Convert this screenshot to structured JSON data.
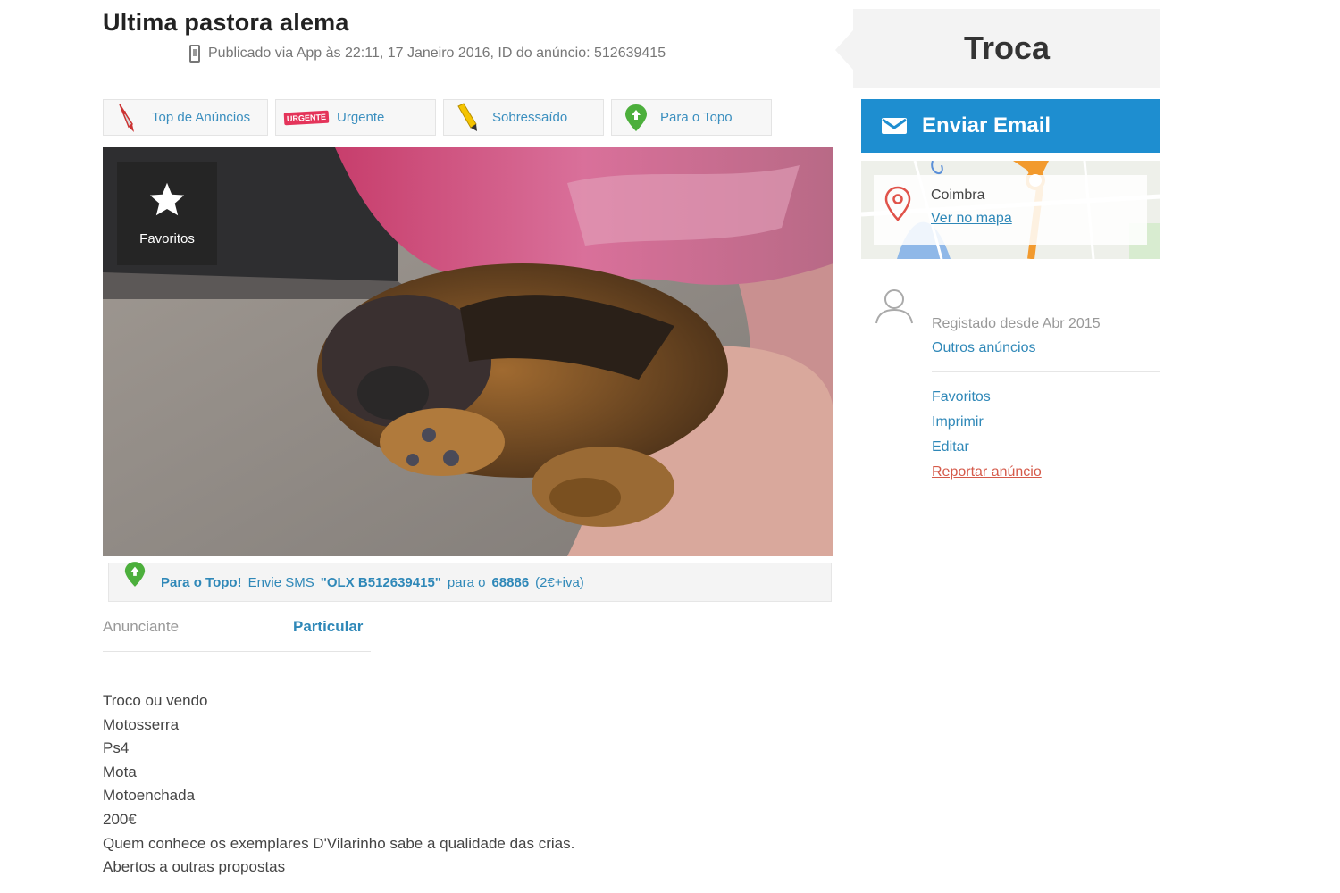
{
  "ad": {
    "title": "Ultima pastora alema",
    "meta": "Publicado via App às 22:11, 17 Janeiro 2016, ID do anúncio: 512639415"
  },
  "promotions": [
    {
      "label": "Top de Anúncios",
      "icon": "rocket-icon"
    },
    {
      "label": "Urgente",
      "icon": "urgent-tag-icon",
      "tag": "URGENTE"
    },
    {
      "label": "Sobressaído",
      "icon": "highlighter-icon"
    },
    {
      "label": "Para o Topo",
      "icon": "map-pin-up-icon"
    }
  ],
  "photo": {
    "favorite_label": "Favoritos"
  },
  "sms": {
    "lead": "Para o Topo!",
    "text1": "Envie SMS",
    "code": "\"OLX B512639415\"",
    "text2": "para o",
    "number": "68886",
    "price": "(2€+iva)"
  },
  "advertiser": {
    "label": "Anunciante",
    "value": "Particular"
  },
  "description": [
    "Troco ou vendo",
    "Motosserra",
    "Ps4",
    "Mota",
    "Motoenchada",
    "200€",
    "Quem conhece os exemplares D'Vilarinho sabe a qualidade das crias.",
    "Abertos a outras propostas"
  ],
  "sidebar": {
    "type_label": "Troca",
    "email_button": "Enviar Email",
    "location": {
      "city": "Coimbra",
      "map_link": "Ver no mapa"
    },
    "user": {
      "registered": "Registado desde Abr 2015",
      "other_ads": "Outros anúncios"
    },
    "actions": [
      "Favoritos",
      "Imprimir",
      "Editar",
      "Reportar anúncio"
    ]
  },
  "colors": {
    "primary_blue": "#1e8ed0",
    "link_blue": "#2f88b8",
    "report_red": "#d55a4a"
  }
}
